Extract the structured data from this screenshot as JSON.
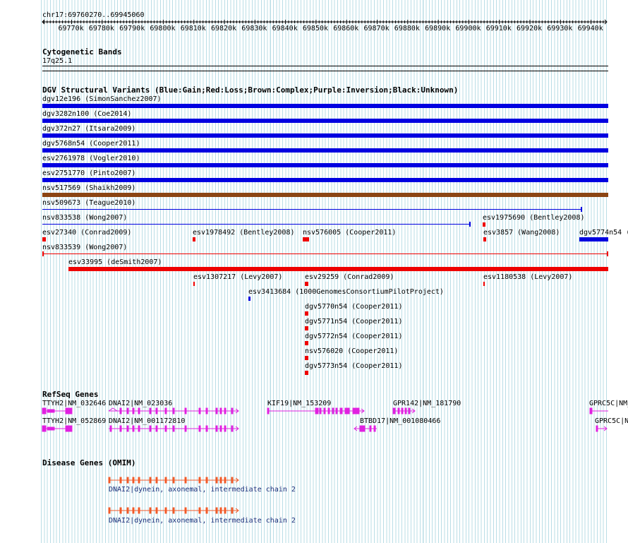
{
  "ruler": {
    "position": "chr17:69760270..69945060",
    "ticks": [
      "69770k",
      "69780k",
      "69790k",
      "69800k",
      "69810k",
      "69820k",
      "69830k",
      "69840k",
      "69850k",
      "69860k",
      "69870k",
      "69880k",
      "69890k",
      "69900k",
      "69910k",
      "69920k",
      "69930k",
      "69940k"
    ]
  },
  "cytoband": {
    "title": "Cytogenetic Bands",
    "band": "17q25.1"
  },
  "dgv": {
    "title": "DGV Structural Variants (Blue:Gain;Red:Loss;Brown:Complex;Purple:Inversion;Black:Unknown)",
    "colors": {
      "gain": "#0000e0",
      "loss": "#ee0000",
      "complex": "#8b4513"
    },
    "full_rows": [
      {
        "label": "dgv12e196 (SimonSanchez2007)",
        "type": "gain"
      },
      {
        "label": "dgv3282n100 (Coe2014)",
        "type": "gain"
      },
      {
        "label": "dgv372n27 (Itsara2009)",
        "type": "gain"
      },
      {
        "label": "dgv5768n54 (Cooper2011)",
        "type": "gain"
      },
      {
        "label": "esv2761978 (Vogler2010)",
        "type": "gain"
      },
      {
        "label": "esv2751770 (Pinto2007)",
        "type": "gain"
      },
      {
        "label": "nsv517569 (Shaikh2009)",
        "type": "complex"
      }
    ],
    "nsv509673": "nsv509673 (Teague2010)",
    "nsv833538": "nsv833538 (Wong2007)",
    "esv1975690": "esv1975690 (Bentley2008)",
    "esv27340": "esv27340 (Conrad2009)",
    "esv1978492": "esv1978492 (Bentley2008)",
    "nsv576005": "nsv576005 (Cooper2011)",
    "esv3857": "esv3857 (Wang2008)",
    "dgv5774n54": "dgv5774n54 (",
    "nsv833539": "nsv833539 (Wong2007)",
    "esv33995": "esv33995 (deSmith2007)",
    "esv1307217": "esv1307217 (Levy2007)",
    "esv29259": "esv29259 (Conrad2009)",
    "esv1180538": "esv1180538 (Levy2007)",
    "esv3413684": "esv3413684 (1000GenomesConsortiumPilotProject)",
    "dgv5770n54": "dgv5770n54 (Cooper2011)",
    "dgv5771n54": "dgv5771n54 (Cooper2011)",
    "dgv5772n54": "dgv5772n54 (Cooper2011)",
    "nsv576020": "nsv576020 (Cooper2011)",
    "dgv5773n54": "dgv5773n54 (Cooper2011)"
  },
  "refseq": {
    "title": "RefSeq Genes",
    "color": "#e020e0",
    "genes": {
      "ttyh2_a": "TTYH2|NM_032646",
      "dnai2_a": "DNAI2|NM_023036",
      "kif19": "KIF19|NM_153209",
      "gpr142": "GPR142|NM_181790",
      "gprc5c_a": "GPRC5C|NM_",
      "ttyh2_b": "TTYH2|NM_052869",
      "dnai2_b": "DNAI2|NM_001172810",
      "btbd17": "BTBD17|NM_001080466",
      "gprc5c_b": "GPRC5C|N"
    }
  },
  "omim": {
    "title": "Disease Genes (OMIM)",
    "color": "#f05a28",
    "entries": [
      "DNAI2|dynein, axonemal, intermediate chain 2",
      "DNAI2|dynein, axonemal, intermediate chain 2"
    ]
  }
}
